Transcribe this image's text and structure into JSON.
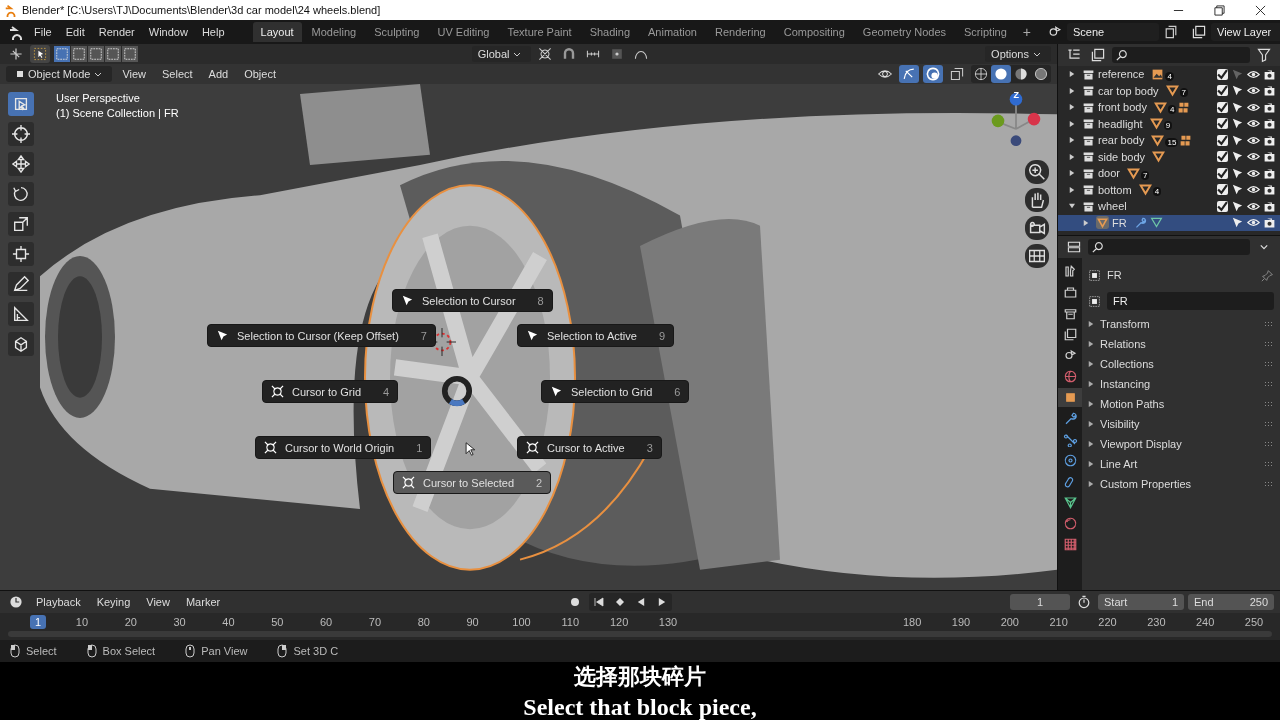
{
  "window": {
    "title": "Blender* [C:\\Users\\TJ\\Documents\\Blender\\3d car model\\24 wheels.blend]"
  },
  "menu": [
    "File",
    "Edit",
    "Render",
    "Window",
    "Help"
  ],
  "workspaces": [
    {
      "label": "Layout",
      "selected": true
    },
    {
      "label": "Modeling",
      "selected": false
    },
    {
      "label": "Sculpting",
      "selected": false
    },
    {
      "label": "UV Editing",
      "selected": false
    },
    {
      "label": "Texture Paint",
      "selected": false
    },
    {
      "label": "Shading",
      "selected": false
    },
    {
      "label": "Animation",
      "selected": false
    },
    {
      "label": "Rendering",
      "selected": false
    },
    {
      "label": "Compositing",
      "selected": false
    },
    {
      "label": "Geometry Nodes",
      "selected": false
    },
    {
      "label": "Scripting",
      "selected": false
    }
  ],
  "add_workspace": "+",
  "scene": "Scene",
  "view_layer": "View Layer",
  "viewport": {
    "transform_orientation": "Global",
    "options": "Options",
    "mode": "Object Mode",
    "menus": [
      "View",
      "Select",
      "Add",
      "Object"
    ],
    "info": [
      "User Perspective",
      "(1) Scene Collection | FR"
    ],
    "gizmo_axis": "Z",
    "tools": [
      {
        "kind": "select",
        "selected": true
      },
      {
        "kind": "cursor",
        "selected": false
      },
      {
        "kind": "move",
        "selected": false
      },
      {
        "kind": "rotate",
        "selected": false
      },
      {
        "kind": "scale",
        "selected": false
      },
      {
        "kind": "transform",
        "selected": false
      },
      {
        "kind": "annotate",
        "selected": false
      },
      {
        "kind": "measure",
        "selected": false
      },
      {
        "kind": "add_cube",
        "selected": false
      }
    ],
    "pie_menu": [
      {
        "label": "Selection to Cursor",
        "hotkey": "8",
        "kind": "selection",
        "selected": false
      },
      {
        "label": "Selection to Cursor (Keep Offset)",
        "hotkey": "7",
        "kind": "selection",
        "selected": false
      },
      {
        "label": "Selection to Active",
        "hotkey": "9",
        "kind": "selection",
        "selected": false
      },
      {
        "label": "Cursor to Grid",
        "hotkey": "4",
        "kind": "cursor",
        "selected": false
      },
      {
        "label": "Selection to Grid",
        "hotkey": "6",
        "kind": "selection",
        "selected": false
      },
      {
        "label": "Cursor to World Origin",
        "hotkey": "1",
        "kind": "cursor",
        "selected": false
      },
      {
        "label": "Cursor to Active",
        "hotkey": "3",
        "kind": "cursor",
        "selected": false
      },
      {
        "label": "Cursor to Selected",
        "hotkey": "2",
        "kind": "cursor",
        "selected": true
      }
    ]
  },
  "outliner": {
    "rows": [
      {
        "kind": "image_collection",
        "name": "reference",
        "count": "4",
        "grid_badge": false,
        "checked": true,
        "selectable": false,
        "expanded": false,
        "selected": false
      },
      {
        "kind": "mesh_collection",
        "name": "car top body",
        "count": "7",
        "grid_badge": false,
        "checked": true,
        "selectable": true,
        "expanded": false,
        "selected": false
      },
      {
        "kind": "mesh_collection",
        "name": "front body",
        "count": "4",
        "grid_badge": true,
        "checked": true,
        "selectable": true,
        "expanded": false,
        "selected": false
      },
      {
        "kind": "mesh_collection",
        "name": "headlight",
        "count": "9",
        "grid_badge": false,
        "checked": true,
        "selectable": true,
        "expanded": false,
        "selected": false
      },
      {
        "kind": "mesh_collection",
        "name": "rear body",
        "count": "15",
        "grid_badge": true,
        "checked": true,
        "selectable": true,
        "expanded": false,
        "selected": false
      },
      {
        "kind": "mesh_collection",
        "name": "side body",
        "grid_badge": false,
        "checked": true,
        "selectable": true,
        "expanded": false,
        "selected": false
      },
      {
        "kind": "mesh_collection",
        "name": "door",
        "count": "7",
        "grid_badge": false,
        "checked": true,
        "selectable": true,
        "expanded": false,
        "selected": false
      },
      {
        "kind": "mesh_collection",
        "name": "bottom",
        "count": "4",
        "grid_badge": false,
        "checked": true,
        "selectable": true,
        "expanded": false,
        "selected": false
      },
      {
        "kind": "collection",
        "name": "wheel",
        "grid_badge": false,
        "checked": true,
        "selectable": true,
        "expanded": true,
        "selected": false,
        "children": [
          {
            "kind": "object",
            "name": "FR",
            "selectable": true,
            "expanded": false,
            "selected": true
          }
        ]
      }
    ]
  },
  "properties": {
    "tabs": [
      {
        "kind": "tool",
        "selected": false
      },
      {
        "kind": "render",
        "selected": false
      },
      {
        "kind": "output",
        "selected": false
      },
      {
        "kind": "view_layer",
        "selected": false
      },
      {
        "kind": "scene",
        "selected": false
      },
      {
        "kind": "world",
        "selected": false
      },
      {
        "kind": "object",
        "selected": true
      },
      {
        "kind": "modifiers",
        "selected": false
      },
      {
        "kind": "particles",
        "selected": false
      },
      {
        "kind": "physics",
        "selected": false
      },
      {
        "kind": "constraints",
        "selected": false
      },
      {
        "kind": "data",
        "selected": false
      },
      {
        "kind": "material",
        "selected": false
      },
      {
        "kind": "texture",
        "selected": false
      }
    ],
    "header": "FR",
    "name_field": "FR",
    "panels": [
      "Transform",
      "Relations",
      "Collections",
      "Instancing",
      "Motion Paths",
      "Visibility",
      "Viewport Display",
      "Line Art",
      "Custom Properties"
    ]
  },
  "timeline": {
    "menus": [
      "Playback",
      "Keying",
      "View",
      "Marker"
    ],
    "current_frame": "1",
    "start_label": "Start",
    "start": "1",
    "end_label": "End",
    "end": "250",
    "playhead": "1",
    "ticks": [
      "10",
      "20",
      "30",
      "40",
      "50",
      "60",
      "70",
      "80",
      "90",
      "100",
      "110",
      "120",
      "130",
      "180",
      "190",
      "200",
      "210",
      "220",
      "230",
      "240",
      "250"
    ]
  },
  "status_bar": [
    {
      "kind": "mouse_left",
      "label": "Select"
    },
    {
      "kind": "mouse_drag",
      "label": "Box Select"
    },
    {
      "kind": "mouse_middle",
      "label": "Pan View"
    },
    {
      "kind": "mouse_right",
      "label": "Set 3D C"
    }
  ],
  "subtitles": {
    "zh": "选择那块碎片",
    "en": "Select that block piece,"
  }
}
